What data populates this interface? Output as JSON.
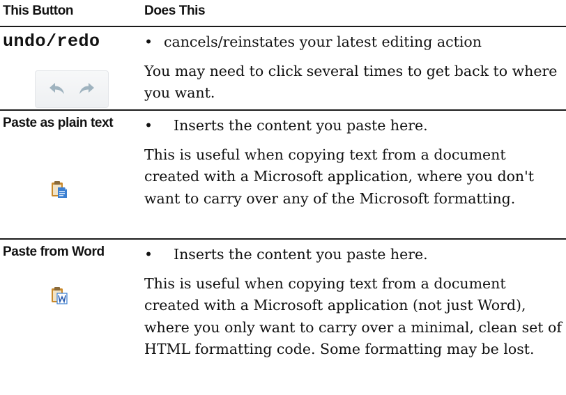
{
  "header": {
    "col_button": "This Button",
    "col_action": "Does This"
  },
  "rows": [
    {
      "name": "undo/redo",
      "bullet": "cancels/reinstates your latest editing action",
      "description": "You may need to click several times to get back to where you want.",
      "icons": [
        "undo-arrow-icon",
        "redo-arrow-icon"
      ]
    },
    {
      "name": "Paste as plain text",
      "bullet": "Inserts the content you paste here.",
      "description": "This is useful when copying text from a document created with a Microsoft application, where you don't want to carry over any of the Microsoft formatting.",
      "icons": [
        "paste-plain-text-icon"
      ]
    },
    {
      "name": "Paste from Word",
      "bullet": "Inserts the content you paste here.",
      "description": "This is useful when copying text from a document created with a Microsoft application (not just Word), where you only want to carry over a minimal, clean set of HTML formatting code. Some formatting may be lost.",
      "icons": [
        "paste-from-word-icon"
      ]
    }
  ],
  "colors": {
    "rule": "#1a1a1a",
    "text": "#111111",
    "arrow": "#9fb3bf",
    "clipboard": "#c9892a",
    "sheet_blue": "#3b7fd1"
  }
}
